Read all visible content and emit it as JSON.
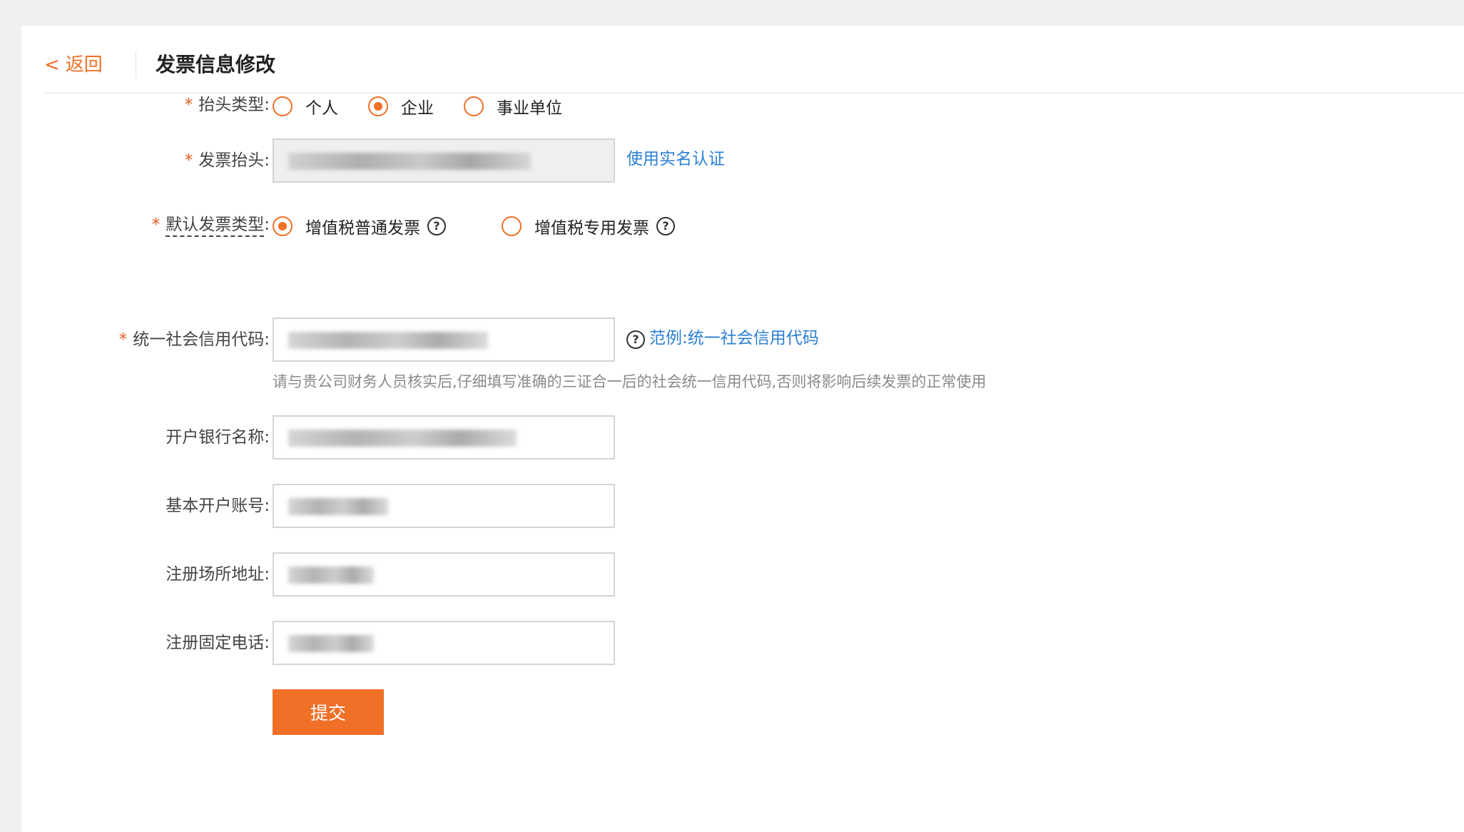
{
  "header": {
    "back_chevron": "<",
    "back_label": "返回",
    "title": "发票信息修改"
  },
  "form": {
    "required_mark": "*",
    "title_type": {
      "label": "抬头类型:",
      "options": [
        "个人",
        "企业",
        "事业单位"
      ],
      "selected": "企业"
    },
    "invoice_title": {
      "label": "发票抬头:",
      "link": "使用实名认证"
    },
    "default_invoice_type": {
      "label": "默认发票类型",
      "colon": ":",
      "options": [
        "增值税普通发票",
        "增值税专用发票"
      ],
      "selected": "增值税普通发票",
      "help_glyph": "?"
    },
    "credit_code": {
      "label": "统一社会信用代码:",
      "example_link": "范例:统一社会信用代码",
      "help_glyph": "?",
      "hint": "请与贵公司财务人员核实后,仔细填写准确的三证合一后的社会统一信用代码,否则将影响后续发票的正常使用"
    },
    "bank_name": {
      "label": "开户银行名称:"
    },
    "bank_account": {
      "label": "基本开户账号:"
    },
    "registered_address": {
      "label": "注册场所地址:"
    },
    "registered_phone": {
      "label": "注册固定电话:"
    },
    "submit_label": "提交"
  },
  "colors": {
    "accent": "#f07028",
    "link": "#2b7fd3",
    "required": "#e55a1b"
  }
}
